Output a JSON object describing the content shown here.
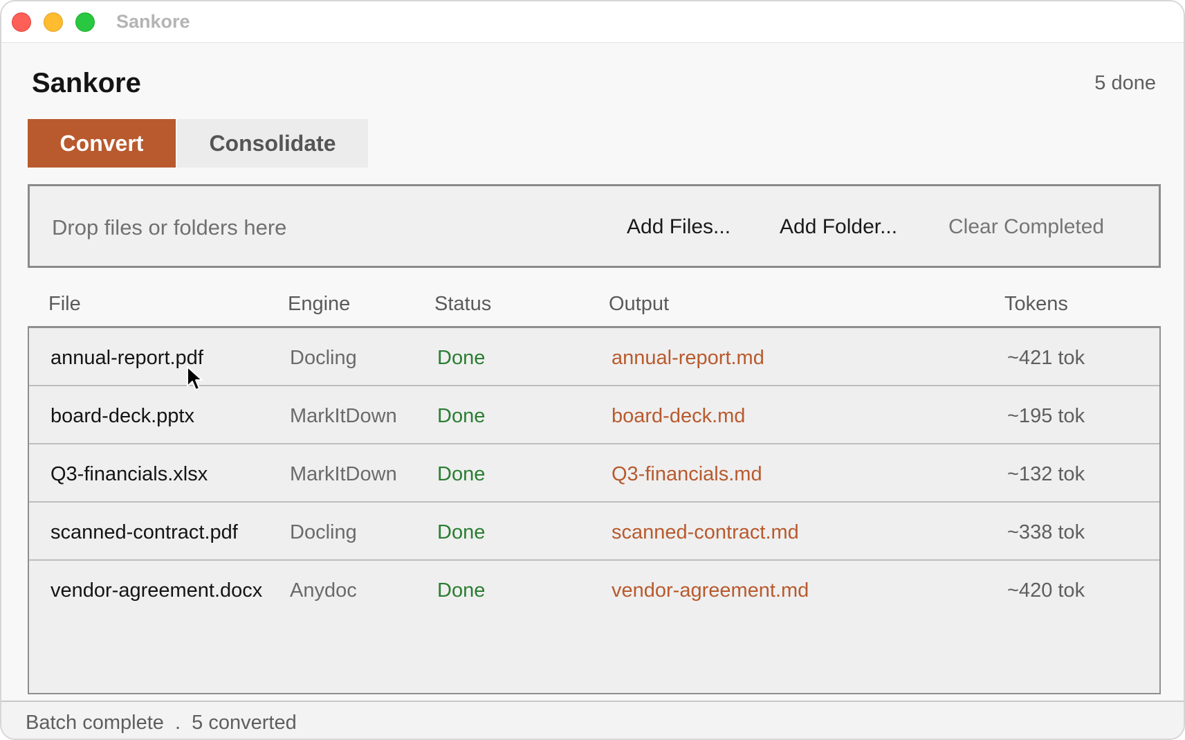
{
  "window": {
    "title": "Sankore"
  },
  "header": {
    "app_title": "Sankore",
    "done_count": "5 done"
  },
  "tabs": [
    {
      "label": "Convert",
      "active": true
    },
    {
      "label": "Consolidate",
      "active": false
    }
  ],
  "dropzone": {
    "hint": "Drop files or folders here",
    "add_files": "Add Files...",
    "add_folder": "Add Folder...",
    "clear_completed": "Clear Completed"
  },
  "table": {
    "columns": [
      "File",
      "Engine",
      "Status",
      "Output",
      "Tokens"
    ],
    "rows": [
      {
        "file": "annual-report.pdf",
        "engine": "Docling",
        "status": "Done",
        "output": "annual-report.md",
        "tokens": "~421 tok"
      },
      {
        "file": "board-deck.pptx",
        "engine": "MarkItDown",
        "status": "Done",
        "output": "board-deck.md",
        "tokens": "~195 tok"
      },
      {
        "file": "Q3-financials.xlsx",
        "engine": "MarkItDown",
        "status": "Done",
        "output": "Q3-financials.md",
        "tokens": "~132 tok"
      },
      {
        "file": "scanned-contract.pdf",
        "engine": "Docling",
        "status": "Done",
        "output": "scanned-contract.md",
        "tokens": "~338 tok"
      },
      {
        "file": "vendor-agreement.docx",
        "engine": "Anydoc",
        "status": "Done",
        "output": "vendor-agreement.md",
        "tokens": "~420 tok"
      }
    ]
  },
  "statusbar": {
    "text": "Batch complete  .  5 converted"
  },
  "colors": {
    "accent": "#b85a2e",
    "status_done": "#2a7d32"
  },
  "icons": [
    "close-window",
    "minimize-window",
    "zoom-window",
    "mouse-cursor"
  ]
}
